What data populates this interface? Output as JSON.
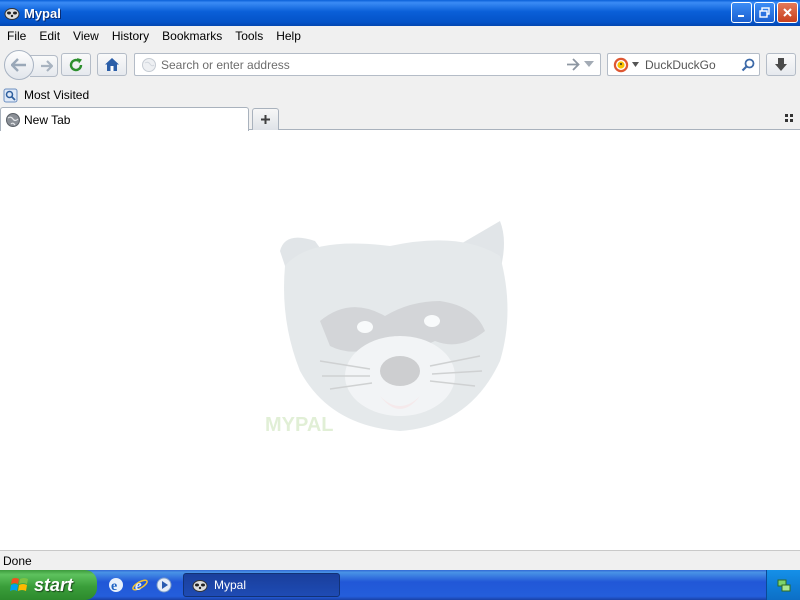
{
  "window": {
    "title": "Mypal"
  },
  "menu": {
    "items": [
      "File",
      "Edit",
      "View",
      "History",
      "Bookmarks",
      "Tools",
      "Help"
    ]
  },
  "navbar": {
    "url_placeholder": "Search or enter address",
    "search_engine": "DuckDuckGo",
    "search_placeholder": "DuckDuckGo"
  },
  "bookmarks": {
    "items": [
      {
        "label": "Most Visited",
        "icon": "bookmark-folder-icon"
      }
    ]
  },
  "tabs": {
    "items": [
      {
        "label": "New Tab",
        "active": true,
        "icon": "globe-icon"
      }
    ]
  },
  "content": {
    "logo_text": "MYPAL",
    "logo": "raccoon-head-watermark"
  },
  "status": {
    "text": "Done"
  },
  "taskbar": {
    "start_label": "start",
    "quicklaunch": [
      "ie-icon",
      "ie-icon",
      "media-player-icon"
    ],
    "tasks": [
      {
        "label": "Mypal",
        "icon": "mypal-icon"
      }
    ]
  },
  "colors": {
    "titlebar": "#0a5fd8",
    "taskbar": "#245edb",
    "start": "#3a9e3a",
    "toolbar_bg": "#f0f0f0"
  }
}
